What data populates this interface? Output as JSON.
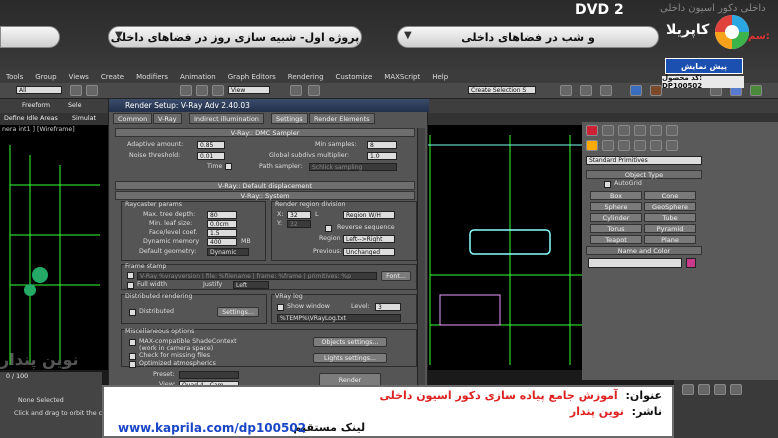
{
  "header": {
    "dvd": "DVD 2",
    "faint_text": "داخلی دکور اسیون داخلی",
    "pill_right": "پروژه اول- شبیه سازی روز در فضاهای داخلی",
    "pill_left": "و شب در فضاهای داخلی",
    "brand": "کاپریلا",
    "red_label": "سم:",
    "preview_button": "پیش نمایش",
    "product_code": "کد محصول: DP100502"
  },
  "menu": [
    "Tools",
    "Group",
    "Views",
    "Create",
    "Modifiers",
    "Animation",
    "Graph Editors",
    "Rendering",
    "Customize",
    "MAXScript",
    "Help"
  ],
  "toolbar": {
    "all": "All",
    "view": "View",
    "create_selection": "Create Selection S"
  },
  "ribbon": {
    "freeform": "Freeform",
    "select": "Sele",
    "define": "Define Idle Areas",
    "simulate": "Simulat"
  },
  "viewport_label": "nera int1 ] [Wireframe]",
  "dialog": {
    "title": "Render Setup: V-Ray Adv 2.40.03",
    "tabs": [
      "Common",
      "V-Ray",
      "Indirect illumination",
      "Settings",
      "Render Elements"
    ],
    "dmc": {
      "header": "V-Ray:: DMC Sampler",
      "adaptive_amount_label": "Adaptive amount:",
      "adaptive_amount": "0.85",
      "noise_threshold_label": "Noise threshold:",
      "noise_threshold": "0.01",
      "time_label": "Time",
      "min_samples_label": "Min samples:",
      "min_samples": "8",
      "global_mult_label": "Global subdivs multiplier:",
      "global_mult": "1.0",
      "path_sampler_label": "Path sampler:",
      "path_sampler": "Schlick sampling"
    },
    "displacement_header": "V-Ray:: Default displacement",
    "system": {
      "header": "V-Ray:: System",
      "raycaster_title": "Raycaster params",
      "max_tree_label": "Max. tree depth:",
      "max_tree": "80",
      "min_leaf_label": "Min. leaf size:",
      "min_leaf": "0.0cm",
      "face_level_label": "Face/level coef.",
      "face_level": "1.5",
      "dynamic_mem_label": "Dynamic memory",
      "dynamic_mem": "400",
      "mb": "MB",
      "default_geom_label": "Default geometry:",
      "default_geom": "Dynamic",
      "region_title": "Render region division",
      "x_label": "X:",
      "x_val": "32",
      "l_label": "L",
      "region_wh": "Region W/H",
      "y_label": "Y:",
      "y_val": "32",
      "reverse_seq": "Reverse sequence",
      "region_label": "Region",
      "region_seq": "Left-->Right",
      "previous_label": "Previous:",
      "previous": "Unchanged",
      "frame_stamp": "Frame stamp",
      "stamp_text": "V-Ray %vrayversion | file: %filename | frame: %frame | primitives: %p",
      "font_btn": "Font...",
      "full_width": "Full width",
      "justify_label": "Justify",
      "justify": "Left",
      "distributed_title": "Distributed rendering",
      "distributed": "Distributed",
      "settings_btn": "Settings...",
      "vraylog_title": "VRay log",
      "show_window": "Show window",
      "level_label": "Level:",
      "level": "3",
      "log_path": "%TEMP%\\VRayLog.txt",
      "misc_title": "Miscellaneous options",
      "max_compat": "MAX-compatible ShadeContext",
      "work_camera": "(work in camera space)",
      "check_missing": "Check for missing files",
      "optimized": "Optimized atmospherics",
      "objects_settings": "Objects settings...",
      "lights_settings": "Lights settings...",
      "preset_label": "Preset:",
      "view_label": "View:",
      "view_value": "Quad 4 - Cam",
      "render_btn": "Render"
    }
  },
  "command_panel": {
    "dropdown": "Standard Primitives",
    "object_type": "Object Type",
    "autogrid": "AutoGrid",
    "buttons": [
      [
        "Box",
        "Cone"
      ],
      [
        "Sphere",
        "GeoSphere"
      ],
      [
        "Cylinder",
        "Tube"
      ],
      [
        "Torus",
        "Pyramid"
      ],
      [
        "Teapot",
        "Plane"
      ]
    ],
    "name_color": "Name and Color",
    "swatch": "#c83a8a"
  },
  "status": {
    "frames": "0 / 100",
    "none_selected": "None Selected",
    "hint": "Click and drag to orbit the ca"
  },
  "watermark": "نوین پندار",
  "info": {
    "title_label": "عنوان:",
    "title": "آموزش جامع پیاده سازی دکور اسیون داخلی",
    "publisher_label": "ناشر:",
    "publisher": "نوین پندار",
    "link_label": "لینک مستقیم:",
    "link": "www.kaprila.com/dp100502"
  }
}
